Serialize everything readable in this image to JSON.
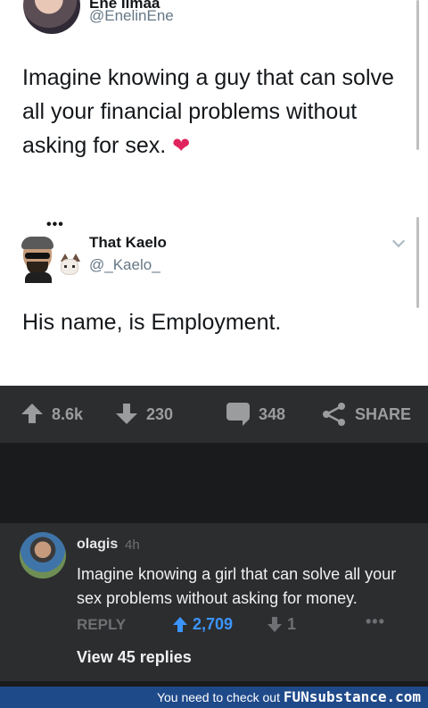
{
  "tweet1": {
    "name": "Ene Ilmaa",
    "handle": "@EnelinEne",
    "text_line1": "Imagine knowing a guy that can solve",
    "text_line2": "all your financial problems without",
    "text_line3": "asking for sex.",
    "emoji": "❤"
  },
  "tweet2": {
    "name": "That Kaelo",
    "handle": "@_Kaelo_",
    "text": "His name, is Employment."
  },
  "actions": {
    "upvotes": "8.6k",
    "downvotes": "230",
    "comments": "348",
    "share": "SHARE"
  },
  "comment": {
    "user": "olagis",
    "time": "4h",
    "text_line1": "Imagine knowing a girl that can solve all your",
    "text_line2": "sex problems without asking for money.",
    "reply": "REPLY",
    "upvotes": "2,709",
    "downvotes": "1",
    "more": "•••",
    "view_replies": "View 45 replies"
  },
  "footer": {
    "text": "You need to check out",
    "brand": "FUNsubstance.com"
  },
  "colors": {
    "upvote_active": "#3b95ff",
    "footer_bg": "#1f4a8a"
  }
}
